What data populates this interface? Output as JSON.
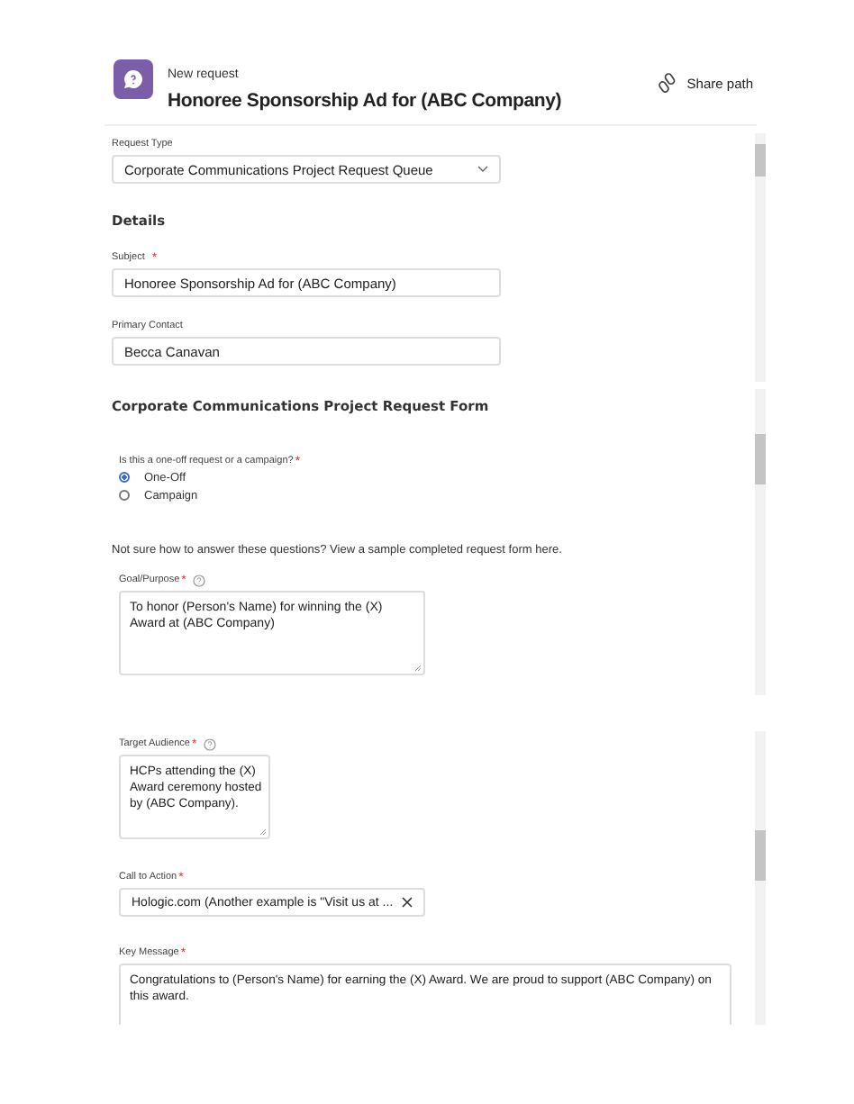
{
  "header": {
    "subtitle": "New request",
    "title": "Honoree Sponsorship Ad for (ABC Company)",
    "share_button": {
      "label": "Share path"
    }
  },
  "panels": [
    {
      "items": [
        {
          "kind": "select",
          "label": "Request Type",
          "value": "Corporate Communications Project Request Queue"
        },
        {
          "kind": "heading",
          "text": "Details"
        },
        {
          "kind": "text_field",
          "label": "Subject",
          "required_mark": "*",
          "value": "Honoree Sponsorship Ad for (ABC Company)"
        },
        {
          "kind": "text_field",
          "label": "Primary Contact",
          "value": "Becca Canavan"
        }
      ]
    },
    {
      "items": [
        {
          "kind": "heading",
          "text": "Corporate Communications Project Request Form"
        },
        {
          "kind": "radio_group",
          "label": "Is this a one-off request or a campaign?",
          "required_mark": "*",
          "options": [
            {
              "label": "One-Off",
              "selected": true
            },
            {
              "label": "Campaign",
              "selected": false
            }
          ]
        },
        {
          "kind": "note",
          "text": "Not sure how to answer these questions? View a sample completed request form here."
        },
        {
          "kind": "textarea",
          "label": "Goal/Purpose",
          "required_mark": "*",
          "help": true,
          "value": "To honor (Person's Name) for winning the (X) Award at (ABC Company)"
        }
      ]
    },
    {
      "items": [
        {
          "kind": "textarea",
          "label": "Target Audience",
          "required_mark": "*",
          "help": true,
          "value": "HCPs attending the (X) Award ceremony hosted by (ABC Company)."
        },
        {
          "kind": "clearable",
          "label": "Call to Action",
          "required_mark": "*",
          "value": "Hologic.com (Another example is \"Visit us at ..."
        },
        {
          "kind": "textarea",
          "label": "Key Message",
          "required_mark": "*",
          "value": "Congratulations to (Person's Name) for earning the (X) Award. We are proud to support (ABC Company) on this award."
        }
      ]
    }
  ]
}
